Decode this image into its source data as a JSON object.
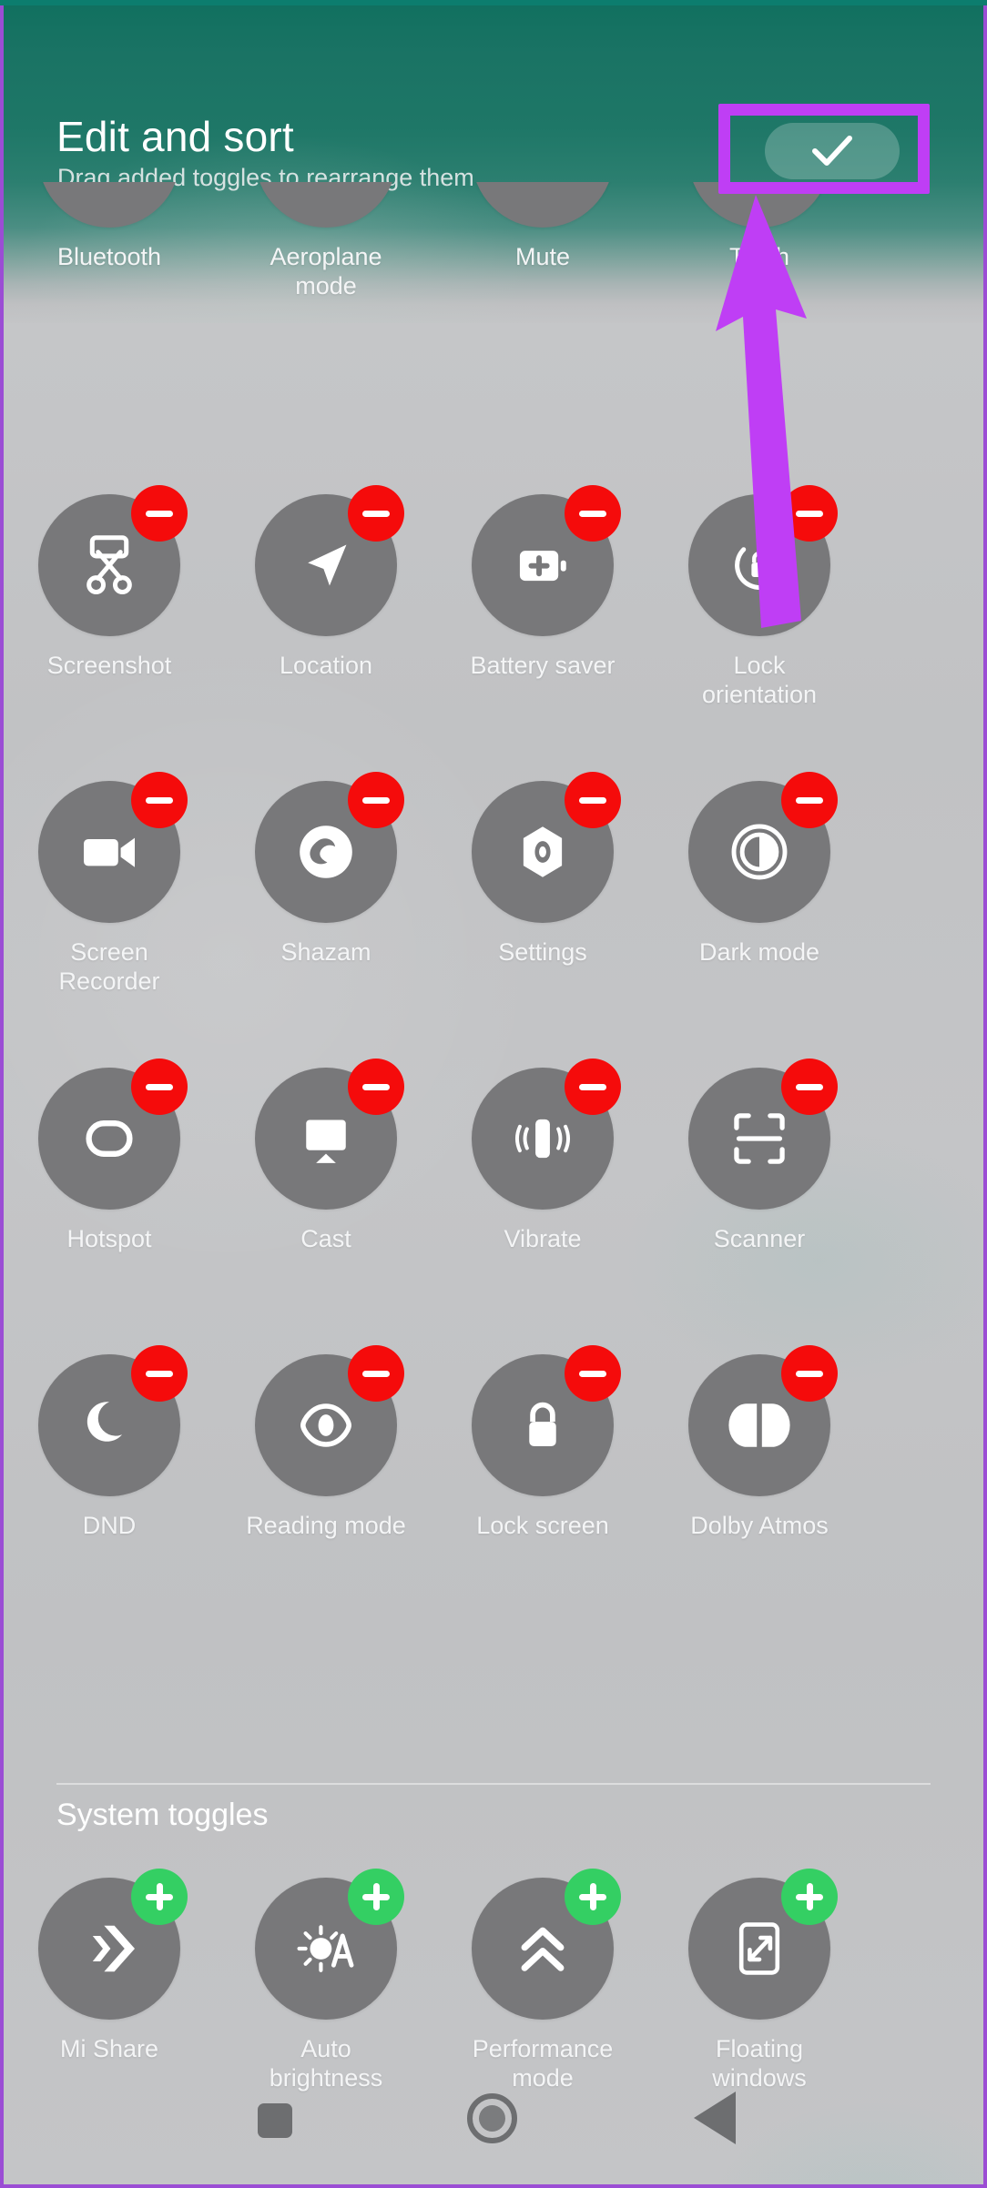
{
  "header": {
    "title": "Edit and sort",
    "subtitle": "Drag added toggles to rearrange them",
    "confirm_label": "Done",
    "confirm_icon": "check-icon",
    "accent_green": "#10705f",
    "highlight_purple": "#bf3ef5"
  },
  "sections": [
    {
      "name": "added_toggles",
      "title": "",
      "badge_type": "remove",
      "badge_color": "#f50b0b",
      "rows": [
        {
          "partial": true,
          "items": [
            {
              "label": "Bluetooth",
              "icon": "bluetooth-icon"
            },
            {
              "label": "Aeroplane\nmode",
              "icon": "airplane-icon"
            },
            {
              "label": "Mute",
              "icon": "mute-icon"
            },
            {
              "label": "Torch",
              "icon": "flashlight-icon"
            }
          ]
        },
        {
          "partial": false,
          "items": [
            {
              "label": "Screenshot",
              "icon": "scissors-icon"
            },
            {
              "label": "Location",
              "icon": "navigation-arrow-icon"
            },
            {
              "label": "Battery saver",
              "icon": "battery-plus-icon"
            },
            {
              "label": "Lock\norientation",
              "icon": "rotation-lock-icon"
            }
          ]
        },
        {
          "partial": false,
          "items": [
            {
              "label": "Screen\nRecorder",
              "icon": "video-camera-icon"
            },
            {
              "label": "Shazam",
              "icon": "shazam-icon"
            },
            {
              "label": "Settings",
              "icon": "settings-gear-icon"
            },
            {
              "label": "Dark mode",
              "icon": "contrast-icon"
            }
          ]
        },
        {
          "partial": false,
          "items": [
            {
              "label": "Hotspot",
              "icon": "hotspot-link-icon"
            },
            {
              "label": "Cast",
              "icon": "cast-icon"
            },
            {
              "label": "Vibrate",
              "icon": "vibrate-icon"
            },
            {
              "label": "Scanner",
              "icon": "scan-frame-icon"
            }
          ]
        },
        {
          "partial": false,
          "items": [
            {
              "label": "DND",
              "icon": "moon-icon"
            },
            {
              "label": "Reading mode",
              "icon": "eye-icon"
            },
            {
              "label": "Lock screen",
              "icon": "padlock-icon"
            },
            {
              "label": "Dolby Atmos",
              "icon": "dolby-icon"
            }
          ]
        }
      ]
    },
    {
      "name": "system_toggles",
      "title": "System toggles",
      "badge_type": "add",
      "badge_color": "#34cf63",
      "rows": [
        {
          "partial": false,
          "items": [
            {
              "label": "Mi Share",
              "icon": "mi-share-icon"
            },
            {
              "label": "Auto\nbrightness",
              "icon": "auto-brightness-icon"
            },
            {
              "label": "Performance\nmode",
              "icon": "double-chevron-up-icon"
            },
            {
              "label": "Floating\nwindows",
              "icon": "floating-window-icon"
            }
          ]
        }
      ]
    }
  ],
  "navigation_bar": {
    "recents_icon": "square-icon",
    "home_icon": "circle-icon",
    "back_icon": "triangle-back-icon"
  },
  "annotation": {
    "highlight_target": "confirm-button",
    "arrow_color": "#bf3ef5"
  }
}
